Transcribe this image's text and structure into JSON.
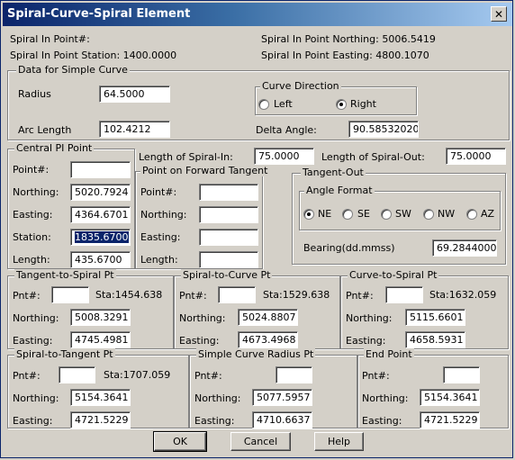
{
  "window": {
    "title": "Spiral-Curve-Spiral Element"
  },
  "header": {
    "spi_point": "Spiral In Point#:",
    "spi_station": "Spiral In Point Station: 1400.0000",
    "spi_northing": "Spiral In Point Northing: 5006.5419",
    "spi_easting": "Spiral In Point Easting: 4800.1070"
  },
  "simple_curve": {
    "group": "Data for Simple Curve",
    "radius_label": "Radius",
    "radius": "64.5000",
    "arc_label": "Arc Length",
    "arc": "102.4212",
    "direction_group": "Curve Direction",
    "left": "Left",
    "right": "Right",
    "delta_label": "Delta Angle:",
    "delta": "90.585320204"
  },
  "central_pi": {
    "group": "Central PI Point",
    "point_label": "Point#:",
    "point": "",
    "northing_label": "Northing:",
    "northing": "5020.7924",
    "easting_label": "Easting:",
    "easting": "4364.6701",
    "station_label": "Station:",
    "station": "1835.6700",
    "length_label": "Length:",
    "length": "435.6700"
  },
  "spiral_in": {
    "label": "Length of Spiral-In:",
    "value": "75.0000"
  },
  "spiral_out": {
    "label": "Length of Spiral-Out:",
    "value": "75.0000"
  },
  "forward_tangent": {
    "group": "Point on Forward Tangent",
    "point_label": "Point#:",
    "northing_label": "Northing:",
    "easting_label": "Easting:",
    "length_label": "Length:",
    "point": "",
    "northing": "",
    "easting": "",
    "length": ""
  },
  "tangent_out": {
    "group": "Tangent-Out",
    "format_group": "Angle Format",
    "options": [
      "NE",
      "SE",
      "SW",
      "NW",
      "AZ"
    ],
    "selected": "NE",
    "bearing_label": "Bearing(dd.mmss)",
    "bearing": "69.28440000"
  },
  "ts": {
    "group": "Tangent-to-Spiral Pt",
    "pnt_label": "Pnt#:",
    "pnt": "",
    "sta": "Sta:1454.638",
    "northing_label": "Northing:",
    "northing": "5008.3291",
    "easting_label": "Easting:",
    "easting": "4745.4981"
  },
  "sc": {
    "group": "Spiral-to-Curve Pt",
    "pnt_label": "Pnt#:",
    "pnt": "",
    "sta": "Sta:1529.638",
    "northing_label": "Northing:",
    "northing": "5024.8807",
    "easting_label": "Easting:",
    "easting": "4673.4968"
  },
  "cs": {
    "group": "Curve-to-Spiral Pt",
    "pnt_label": "Pnt#:",
    "pnt": "",
    "sta": "Sta:1632.059",
    "northing_label": "Northing:",
    "northing": "5115.6601",
    "easting_label": "Easting:",
    "easting": "4658.5931"
  },
  "st": {
    "group": "Spiral-to-Tangent Pt",
    "pnt_label": "Pnt#:",
    "pnt": "",
    "sta": "Sta:1707.059",
    "northing_label": "Northing:",
    "northing": "5154.3641",
    "easting_label": "Easting:",
    "easting": "4721.5229"
  },
  "rp": {
    "group": "Simple Curve Radius Pt",
    "pnt_label": "Pnt#:",
    "pnt": "",
    "northing_label": "Northing:",
    "northing": "5077.5957",
    "easting_label": "Easting:",
    "easting": "4710.6637"
  },
  "ep": {
    "group": "End Point",
    "pnt_label": "Pnt#:",
    "pnt": "",
    "northing_label": "Northing:",
    "northing": "5154.3641",
    "easting_label": "Easting:",
    "easting": "4721.5229"
  },
  "buttons": {
    "ok": "OK",
    "cancel": "Cancel",
    "help": "Help"
  }
}
